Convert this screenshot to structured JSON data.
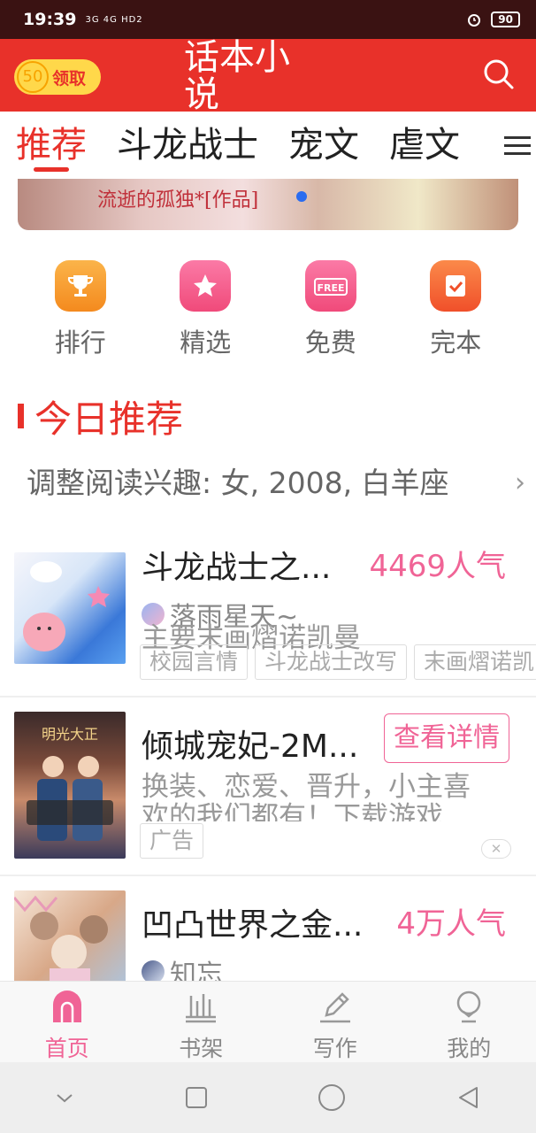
{
  "status_bar": {
    "time": "19:39",
    "network": "3G 4G HD2",
    "battery": "90"
  },
  "header": {
    "coin_value": "50",
    "coin_label": "领取",
    "title": "话本小说"
  },
  "tabs": [
    {
      "label": "推荐",
      "active": true
    },
    {
      "label": "斗龙战士"
    },
    {
      "label": "宠文"
    },
    {
      "label": "虐文"
    }
  ],
  "banner": {
    "text": "流逝的孤独*[作品]"
  },
  "categories": [
    {
      "label": "排行",
      "icon": "trophy-icon",
      "color": "#f6a23a"
    },
    {
      "label": "精选",
      "icon": "star-icon",
      "color": "#f25a8a"
    },
    {
      "label": "免费",
      "icon": "free-icon",
      "color": "#f25a8a"
    },
    {
      "label": "完本",
      "icon": "check-icon",
      "color": "#f46a3a"
    }
  ],
  "section": {
    "title": "今日推荐"
  },
  "interest": {
    "text": "调整阅读兴趣: 女, 2008, 白羊座"
  },
  "books": [
    {
      "title": "斗龙战士之...",
      "popularity": "4469人气",
      "author": "落雨星天~",
      "desc": "主要末画熠诺凯曼",
      "tags": [
        "校园言情",
        "斗龙战士改写",
        "末画熠诺凯"
      ]
    },
    {
      "title": "倾城宠妃-2M...",
      "button": "查看详情",
      "desc_line1": "换装、恋爱、晋升，小主喜",
      "desc_line2": "欢的我们都有！下载游戏",
      "tag": "广告",
      "cover_text": "明光大正"
    },
    {
      "title": "凹凸世界之金...",
      "popularity": "4万人气",
      "author": "知忘"
    }
  ],
  "bottom_nav": [
    {
      "label": "首页",
      "icon": "home-icon",
      "active": true
    },
    {
      "label": "书架",
      "icon": "bookshelf-icon"
    },
    {
      "label": "写作",
      "icon": "pencil-icon"
    },
    {
      "label": "我的",
      "icon": "profile-icon"
    }
  ],
  "colors": {
    "brand": "#e8312a",
    "accent": "#f06496",
    "coin": "#ffd84a"
  }
}
